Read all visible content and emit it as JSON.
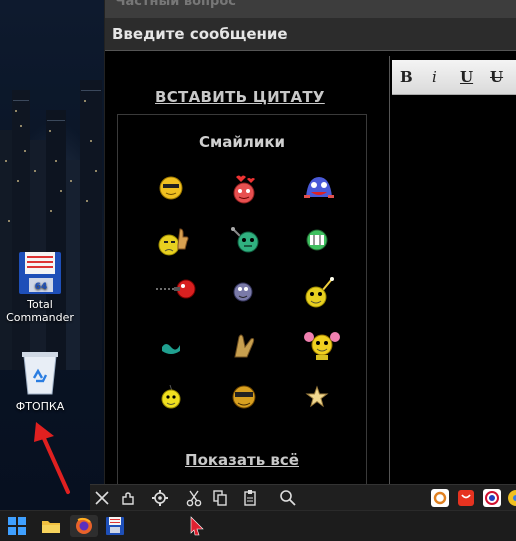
{
  "desktop": {
    "icons": [
      {
        "label": "Total\nCommander"
      },
      {
        "label": "ФТОПКА"
      }
    ]
  },
  "page": {
    "top_strip": "Частный вопрос",
    "message_header": "Введите сообщение",
    "insert_quote": "ВСТАВИТЬ ЦИТАТУ",
    "smilies_title": "Смайлики",
    "show_all": "Показать всё"
  },
  "editor": {
    "bold": "B",
    "italic": "i",
    "underline": "U",
    "strike": "U"
  }
}
